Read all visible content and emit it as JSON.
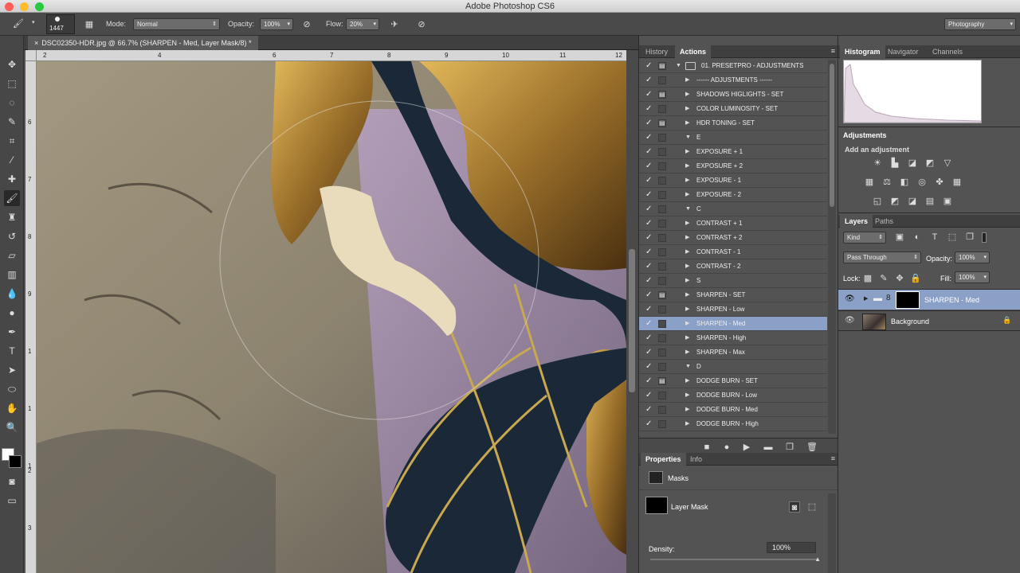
{
  "window": {
    "title": "Adobe Photoshop CS6"
  },
  "options": {
    "brush_size": "1447",
    "mode_label": "Mode:",
    "mode_value": "Normal",
    "opacity_label": "Opacity:",
    "opacity_value": "100%",
    "flow_label": "Flow:",
    "flow_value": "20%",
    "workspace": "Photography"
  },
  "document": {
    "tab_title": "DSC02350-HDR.jpg @ 66.7% (SHARPEN - Med, Layer Mask/8) *"
  },
  "ruler": {
    "h": [
      "2",
      "4",
      "6",
      "7",
      "8",
      "9",
      "10",
      "11",
      "12"
    ],
    "v": [
      "6",
      "7",
      "8",
      "9",
      "1",
      "1",
      "1",
      "2",
      "3"
    ]
  },
  "actions": {
    "tabs": [
      "History",
      "Actions"
    ],
    "rows": [
      {
        "c": "✓",
        "m": true,
        "e": "▼",
        "f": true,
        "l": "01. PRESETPRO - ADJUSTMENTS",
        "i": 0
      },
      {
        "c": "✓",
        "m": false,
        "e": "▶",
        "l": "------ ADJUSTMENTS ------",
        "i": 1
      },
      {
        "c": "✓",
        "m": true,
        "e": "▶",
        "l": "SHADOWS HIGLIGHTS - SET",
        "i": 1
      },
      {
        "c": "✓",
        "m": false,
        "e": "▶",
        "l": "COLOR LUMINOSITY - SET",
        "i": 1
      },
      {
        "c": "✓",
        "m": true,
        "e": "▶",
        "l": "HDR TONING - SET",
        "i": 1
      },
      {
        "c": "✓",
        "m": false,
        "e": "▼",
        "l": "E",
        "i": 1
      },
      {
        "c": "✓",
        "m": false,
        "e": "▶",
        "l": "EXPOSURE + 1",
        "i": 1
      },
      {
        "c": "✓",
        "m": false,
        "e": "▶",
        "l": "EXPOSURE + 2",
        "i": 1
      },
      {
        "c": "✓",
        "m": false,
        "e": "▶",
        "l": "EXPOSURE  - 1",
        "i": 1
      },
      {
        "c": "✓",
        "m": false,
        "e": "▶",
        "l": "EXPOSURE  - 2",
        "i": 1
      },
      {
        "c": "✓",
        "m": false,
        "e": "▼",
        "l": "C",
        "i": 1
      },
      {
        "c": "✓",
        "m": false,
        "e": "▶",
        "l": "CONTRAST + 1",
        "i": 1
      },
      {
        "c": "✓",
        "m": false,
        "e": "▶",
        "l": "CONTRAST + 2",
        "i": 1
      },
      {
        "c": "✓",
        "m": false,
        "e": "▶",
        "l": "CONTRAST  - 1",
        "i": 1
      },
      {
        "c": "✓",
        "m": false,
        "e": "▶",
        "l": "CONTRAST  - 2",
        "i": 1
      },
      {
        "c": "✓",
        "m": false,
        "e": "▶",
        "l": "S",
        "i": 1
      },
      {
        "c": "✓",
        "m": true,
        "e": "▶",
        "l": "SHARPEN - SET",
        "i": 1
      },
      {
        "c": "✓",
        "m": false,
        "e": "▶",
        "l": "SHARPEN - Low",
        "i": 1
      },
      {
        "c": "✓",
        "m": false,
        "e": "▶",
        "l": "SHARPEN - Med",
        "i": 1,
        "s": true
      },
      {
        "c": "✓",
        "m": false,
        "e": "▶",
        "l": "SHARPEN - High",
        "i": 1
      },
      {
        "c": "✓",
        "m": false,
        "e": "▶",
        "l": "SHARPEN - Max",
        "i": 1
      },
      {
        "c": "✓",
        "m": false,
        "e": "▼",
        "l": "D",
        "i": 1
      },
      {
        "c": "✓",
        "m": true,
        "e": "▶",
        "l": "DODGE BURN - SET",
        "i": 1
      },
      {
        "c": "✓",
        "m": false,
        "e": "▶",
        "l": "DODGE BURN - Low",
        "i": 1
      },
      {
        "c": "✓",
        "m": false,
        "e": "▶",
        "l": "DODGE BURN - Med",
        "i": 1
      },
      {
        "c": "✓",
        "m": false,
        "e": "▶",
        "l": "DODGE BURN - High",
        "i": 1
      }
    ]
  },
  "properties": {
    "tabs": [
      "Properties",
      "Info"
    ],
    "section": "Masks",
    "mask_name": "Layer Mask",
    "density_label": "Density:",
    "density_value": "100%"
  },
  "histogram": {
    "tabs": [
      "Histogram",
      "Navigator",
      "Channels"
    ]
  },
  "adjustments": {
    "title": "Adjustments",
    "subtitle": "Add an adjustment"
  },
  "layers": {
    "tabs": [
      "Layers",
      "Paths"
    ],
    "kind": "Kind",
    "blend": "Pass Through",
    "opacity_label": "Opacity:",
    "opacity_value": "100%",
    "lock_label": "Lock:",
    "fill_label": "Fill:",
    "fill_value": "100%",
    "items": [
      "SHARPEN - Med",
      "Background"
    ]
  }
}
